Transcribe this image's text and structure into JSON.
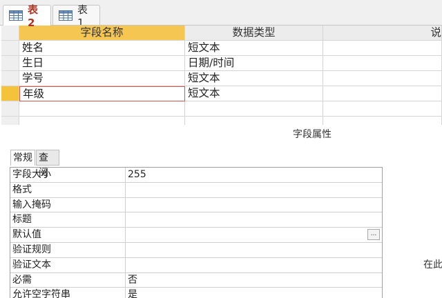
{
  "tabs": [
    {
      "label": "表2",
      "active": true
    },
    {
      "label": "表1",
      "active": false
    }
  ],
  "grid": {
    "headers": {
      "name": "字段名称",
      "type": "数据类型",
      "desc": "说"
    },
    "rows": [
      {
        "name": "姓名",
        "type": "短文本"
      },
      {
        "name": "生日",
        "type": "日期/时间"
      },
      {
        "name": "学号",
        "type": "短文本"
      },
      {
        "name": "年级",
        "type": "短文本"
      }
    ]
  },
  "properties": {
    "section_title": "字段属性",
    "tabs": [
      "常规",
      "查阅"
    ],
    "rows": [
      {
        "label": "字段大小",
        "value": "255"
      },
      {
        "label": "格式",
        "value": ""
      },
      {
        "label": "输入掩码",
        "value": ""
      },
      {
        "label": "标题",
        "value": ""
      },
      {
        "label": "默认值",
        "value": ""
      },
      {
        "label": "验证规则",
        "value": ""
      },
      {
        "label": "验证文本",
        "value": ""
      },
      {
        "label": "必需",
        "value": "否"
      },
      {
        "label": "允许空字符串",
        "value": "是"
      }
    ],
    "builder_button": "...",
    "help_text": "在此"
  },
  "colors": {
    "active_tab_text": "#b0331f",
    "selected_header": "#f6c653",
    "current_row_selector": "#f4c23b",
    "focus_border": "#d9534f"
  },
  "icons": {
    "tab_icon": "table-icon"
  }
}
